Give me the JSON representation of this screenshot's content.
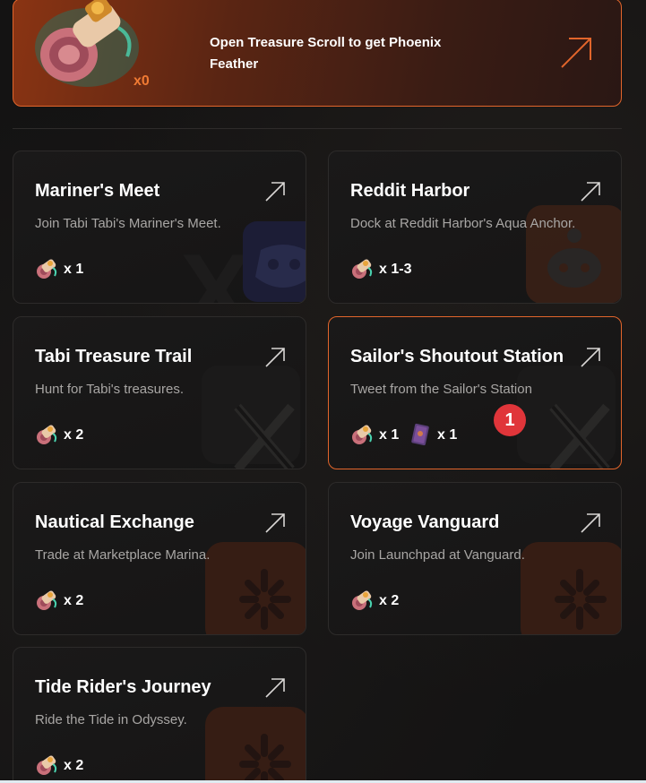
{
  "banner": {
    "count": "x0",
    "text": "Open Treasure Scroll to get Phoenix Feather"
  },
  "cards": [
    {
      "title": "Mariner's Meet",
      "desc": "Join Tabi Tabi's Mariner's Meet.",
      "rewards": [
        {
          "icon": "scroll-icon",
          "label": "x 1"
        }
      ],
      "watermark": "discord"
    },
    {
      "title": "Reddit Harbor",
      "desc": "Dock at Reddit Harbor's Aqua Anchor.",
      "rewards": [
        {
          "icon": "scroll-icon",
          "label": "x 1-3"
        }
      ],
      "watermark": "reddit"
    },
    {
      "title": "Tabi Treasure Trail",
      "desc": "Hunt for Tabi's treasures.",
      "rewards": [
        {
          "icon": "scroll-icon",
          "label": "x 2"
        }
      ],
      "watermark": "x"
    },
    {
      "title": "Sailor's Shoutout Station",
      "desc": "Tweet from the Sailor's Station",
      "rewards": [
        {
          "icon": "scroll-icon",
          "label": "x 1"
        },
        {
          "icon": "book-icon",
          "label": "x 1"
        }
      ],
      "watermark": "x",
      "badge": "1"
    },
    {
      "title": "Nautical Exchange",
      "desc": "Trade at Marketplace Marina.",
      "rewards": [
        {
          "icon": "scroll-icon",
          "label": "x 2"
        }
      ],
      "watermark": "spark"
    },
    {
      "title": "Voyage Vanguard",
      "desc": "Join Launchpad at Vanguard.",
      "rewards": [
        {
          "icon": "scroll-icon",
          "label": "x 2"
        }
      ],
      "watermark": "spark"
    },
    {
      "title": "Tide Rider's Journey",
      "desc": "Ride the Tide in Odyssey.",
      "rewards": [
        {
          "icon": "scroll-icon",
          "label": "x 2"
        }
      ],
      "watermark": "spark"
    }
  ]
}
